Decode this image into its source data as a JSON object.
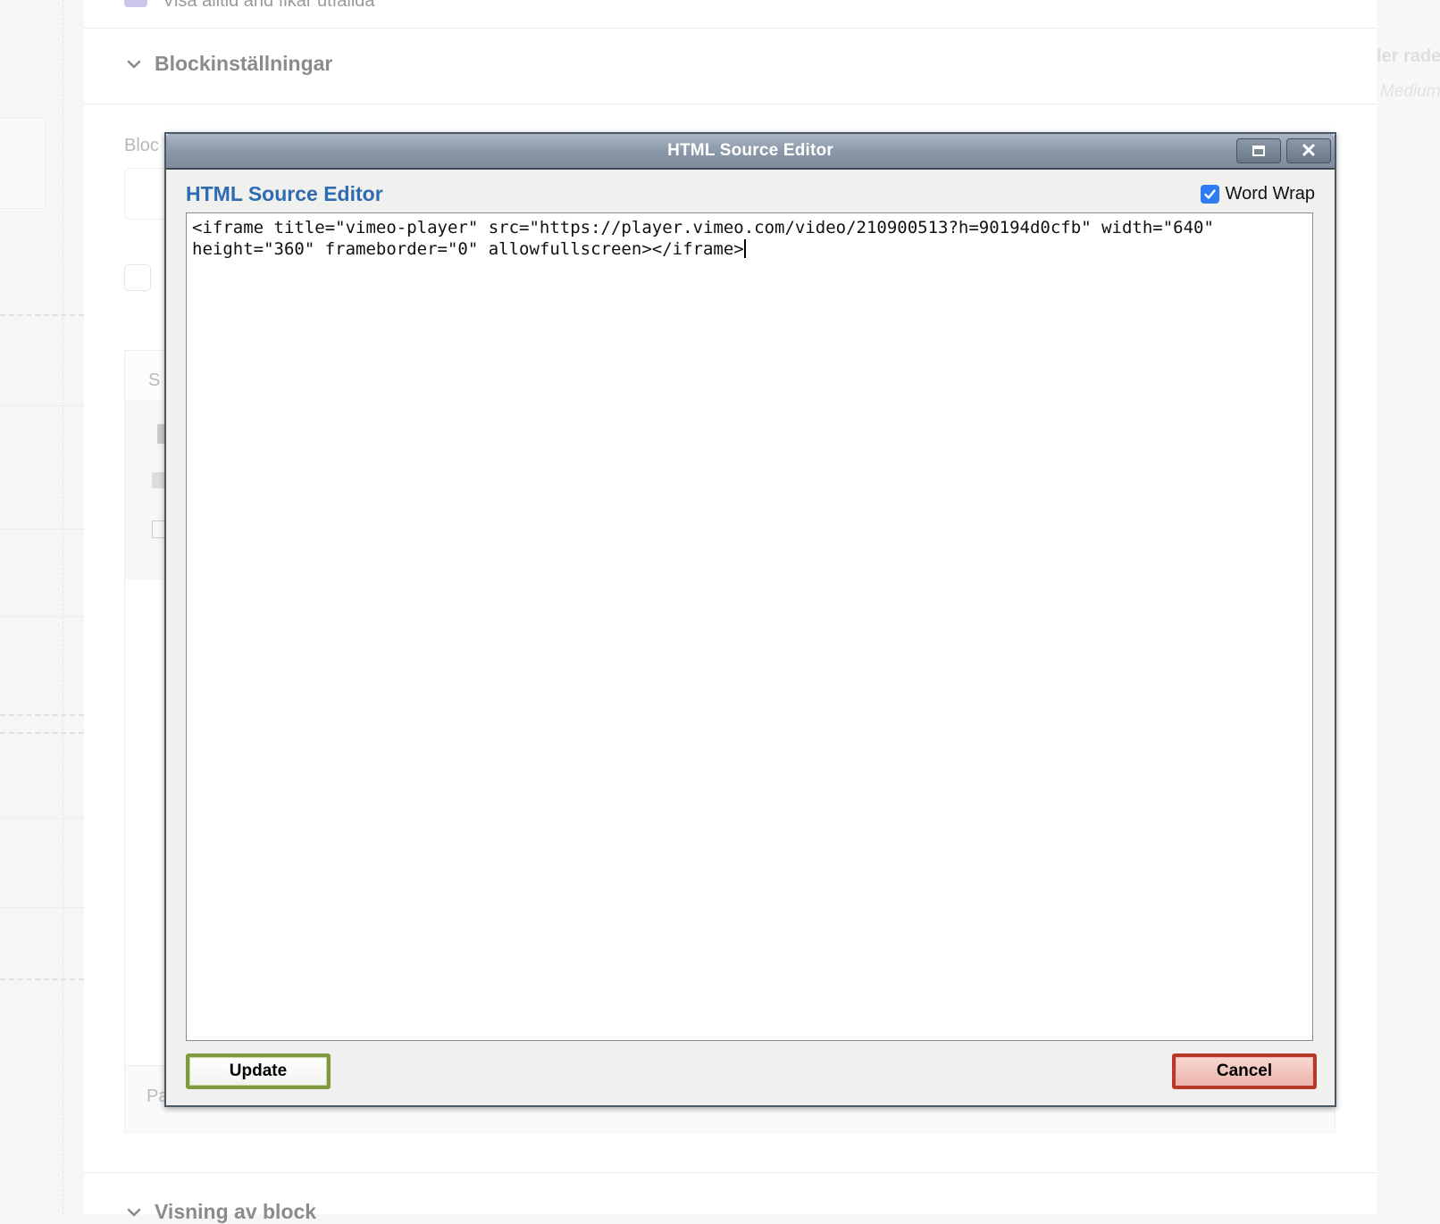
{
  "background": {
    "top_checkbox_label": "Visa alltid and fikar utfällda",
    "section_block_settings": "Blockinställningar",
    "block_field_label_partial": "Bloc",
    "pane_header_partial": "S",
    "pane_footer_partial": "Pa",
    "section_block_display": "Visning av block",
    "right_faded_text": "ler rade",
    "right_faded_italic": "Medium"
  },
  "dialog": {
    "window_title": "HTML Source Editor",
    "heading": "HTML Source Editor",
    "word_wrap_label": "Word Wrap",
    "word_wrap_checked": true,
    "source_code": "<iframe title=\"vimeo-player\" src=\"https://player.vimeo.com/video/210900513?h=90194d0cfb\" width=\"640\" height=\"360\" frameborder=\"0\" allowfullscreen></iframe>",
    "update_label": "Update",
    "cancel_label": "Cancel",
    "maximize_icon": "maximize-icon",
    "close_icon": "close-icon"
  },
  "colors": {
    "heading_blue": "#2f6bb0",
    "update_border": "#7f9a3e",
    "cancel_border": "#b8392b",
    "titlebar": "#8896a6"
  }
}
